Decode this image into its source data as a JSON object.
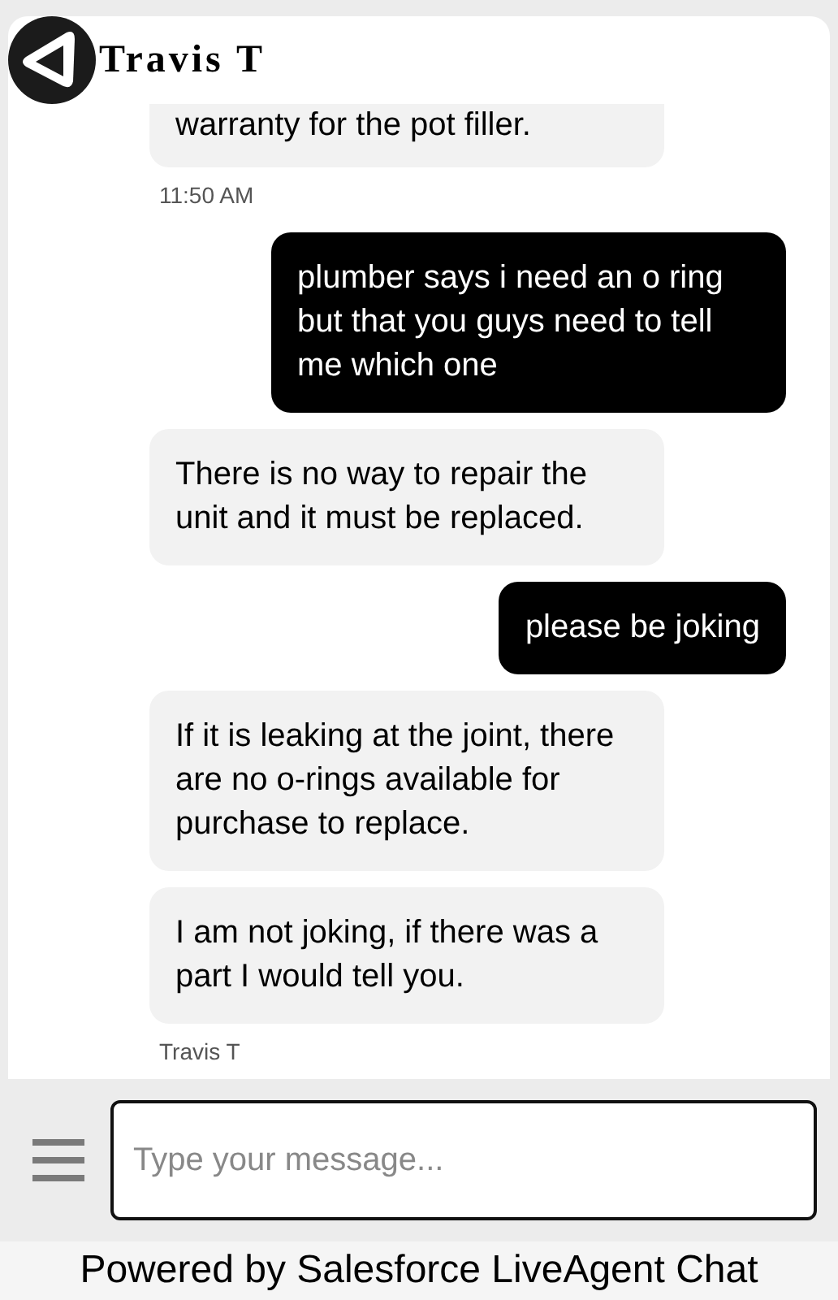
{
  "header": {
    "agent_name": "Travis T"
  },
  "messages": [
    {
      "kind": "agent",
      "text": "warranty for the pot filler.",
      "meta": "11:50 AM"
    },
    {
      "kind": "customer",
      "text": "plumber says i need an o ring but that you guys need to tell me which one"
    },
    {
      "kind": "agent",
      "text": "There is no way to repair the unit and it must be replaced."
    },
    {
      "kind": "customer",
      "text": "please be joking"
    },
    {
      "kind": "agent",
      "text": "If it is leaking at the joint, there are no o-rings available for purchase to replace."
    },
    {
      "kind": "agent",
      "text": "I am not joking, if there was a part I would tell you.",
      "meta": "Travis T"
    }
  ],
  "composer": {
    "placeholder": "Type your message..."
  },
  "footer": "Powered by Salesforce LiveAgent Chat"
}
